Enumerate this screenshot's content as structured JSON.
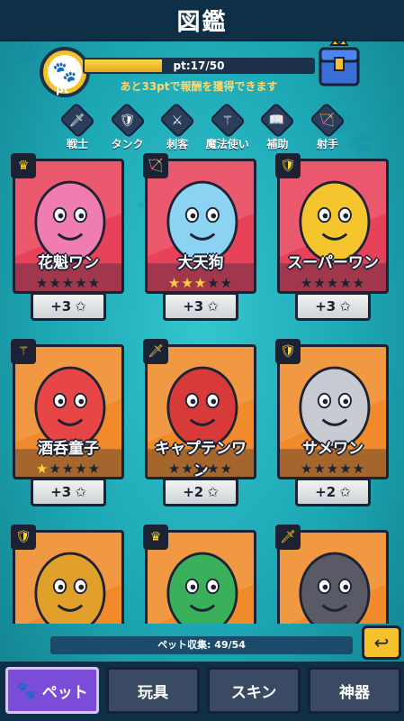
{
  "header": {
    "title": "図鑑"
  },
  "progress": {
    "pt_label": "pt",
    "text": "pt:17/50",
    "fraction": 0.34,
    "message": "あと33ptで報酬を獲得できます"
  },
  "filters": [
    {
      "label": "戦士",
      "icon": "sword-icon"
    },
    {
      "label": "タンク",
      "icon": "shield-icon"
    },
    {
      "label": "刺客",
      "icon": "dagger-icon"
    },
    {
      "label": "魔法使い",
      "icon": "staff-icon"
    },
    {
      "label": "補助",
      "icon": "book-icon"
    },
    {
      "label": "射手",
      "icon": "bow-icon"
    }
  ],
  "cards": [
    {
      "name": "花魁ワン",
      "stars": 0,
      "bonus": "+3",
      "rank_icon": "crown-icon",
      "bg": "#e8425a",
      "accent": "#f07db0"
    },
    {
      "name": "大天狗",
      "stars": 3,
      "bonus": "+3",
      "rank_icon": "bow-icon",
      "bg": "#e8425a",
      "accent": "#8bd3f0"
    },
    {
      "name": "スーパーワン",
      "stars": 0,
      "bonus": "+3",
      "rank_icon": "shield-icon",
      "bg": "#e8425a",
      "accent": "#f4c52c"
    },
    {
      "name": "酒呑童子",
      "stars": 1,
      "bonus": "+3",
      "rank_icon": "staff-icon",
      "bg": "#f08a2a",
      "accent": "#e84646"
    },
    {
      "name": "キャプテンワン",
      "stars": 0,
      "bonus": "+2",
      "rank_icon": "sword-icon",
      "bg": "#f08a2a",
      "accent": "#d83a3a"
    },
    {
      "name": "サメワン",
      "stars": 0,
      "bonus": "+2",
      "rank_icon": "shield-icon",
      "bg": "#f08a2a",
      "accent": "#c8ccd2"
    },
    {
      "name": "",
      "stars": 0,
      "bonus": "",
      "rank_icon": "shield-icon",
      "bg": "#f08a2a",
      "accent": "#e0a02a"
    },
    {
      "name": "",
      "stars": 0,
      "bonus": "",
      "rank_icon": "crown-icon",
      "bg": "#f08a2a",
      "accent": "#3ab05a"
    },
    {
      "name": "",
      "stars": 0,
      "bonus": "",
      "rank_icon": "sword-icon",
      "bg": "#f08a2a",
      "accent": "#5a5a66"
    }
  ],
  "collection": {
    "text": "ペット収集: 49/54"
  },
  "tabs": [
    {
      "label": "ペット",
      "active": true
    },
    {
      "label": "玩具",
      "active": false
    },
    {
      "label": "スキン",
      "active": false
    },
    {
      "label": "神器",
      "active": false
    }
  ],
  "colors": {
    "accent": "#f6c12a",
    "active_tab": "#7a4cd8"
  }
}
